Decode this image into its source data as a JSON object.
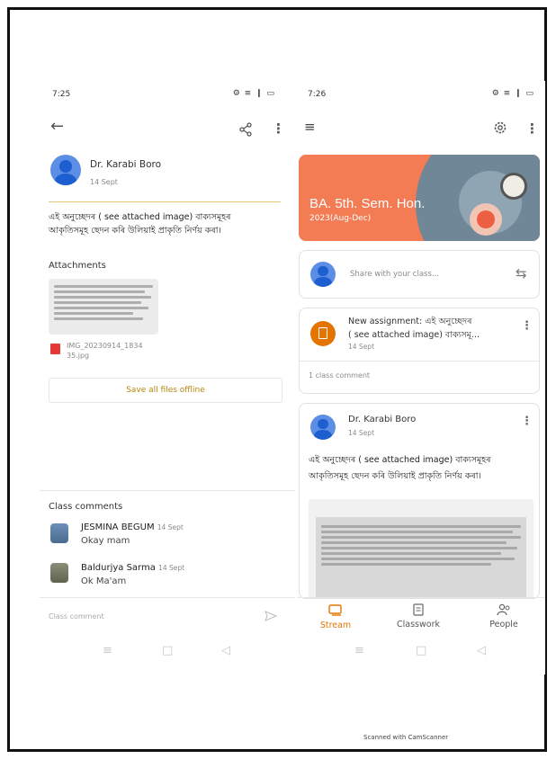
{
  "left": {
    "status_time": "7:25",
    "status_icons": "⚙ ≡ ❙ ▭",
    "author": "Dr. Karabi Boro",
    "date": "14 Sept",
    "body_line1": "এই অনুচ্ছেদৰ ( see attached image) বাক্যসমূহৰ",
    "body_line2": "আকৃতিসমূহ ছেদন কৰি উলিয়াই প্ৰাকৃতি নিৰ্ণয় কৰা।",
    "attachments_label": "Attachments",
    "file_name_line1": "IMG_20230914_1834",
    "file_name_line2": "35.jpg",
    "save_offline_label": "Save all files offline",
    "class_comments_label": "Class comments",
    "comments": [
      {
        "name": "JESMINA BEGUM",
        "date": "14 Sept",
        "text": "Okay mam"
      },
      {
        "name": "Baldurjya Sarma",
        "date": "14 Sept",
        "text": "Ok Ma'am"
      }
    ],
    "comment_placeholder": "Class comment"
  },
  "right": {
    "status_time": "7:26",
    "status_icons": "⚙ ≡ ❙ ▭",
    "banner_title": "BA. 5th. Sem. Hon.",
    "banner_subtitle": "2023(Aug-Dec)",
    "share_placeholder": "Share with your class...",
    "assignment_title_line1": "New assignment: এই অনুচ্ছেদৰ",
    "assignment_title_line2": "( see attached image) বাক্যসমূ...",
    "assignment_date": "14 Sept",
    "class_comment_count": "1 class comment",
    "post_author": "Dr. Karabi Boro",
    "post_date": "14 Sept",
    "post_line1": "এই অনুচ্ছেদৰ ( see attached image) বাক্যসমূহৰ",
    "post_line2": "আকৃতিসমূহ ছেদন কৰি উলিয়াই প্ৰাকৃতি নিৰ্ণয় কৰা।",
    "nav": [
      {
        "label": "Stream",
        "icon": "stream-icon"
      },
      {
        "label": "Classwork",
        "icon": "classwork-icon"
      },
      {
        "label": "People",
        "icon": "people-icon"
      }
    ],
    "accent_color": "#e37400",
    "banner_color": "#f37c55"
  },
  "footer_text": "Scanned with CamScanner"
}
